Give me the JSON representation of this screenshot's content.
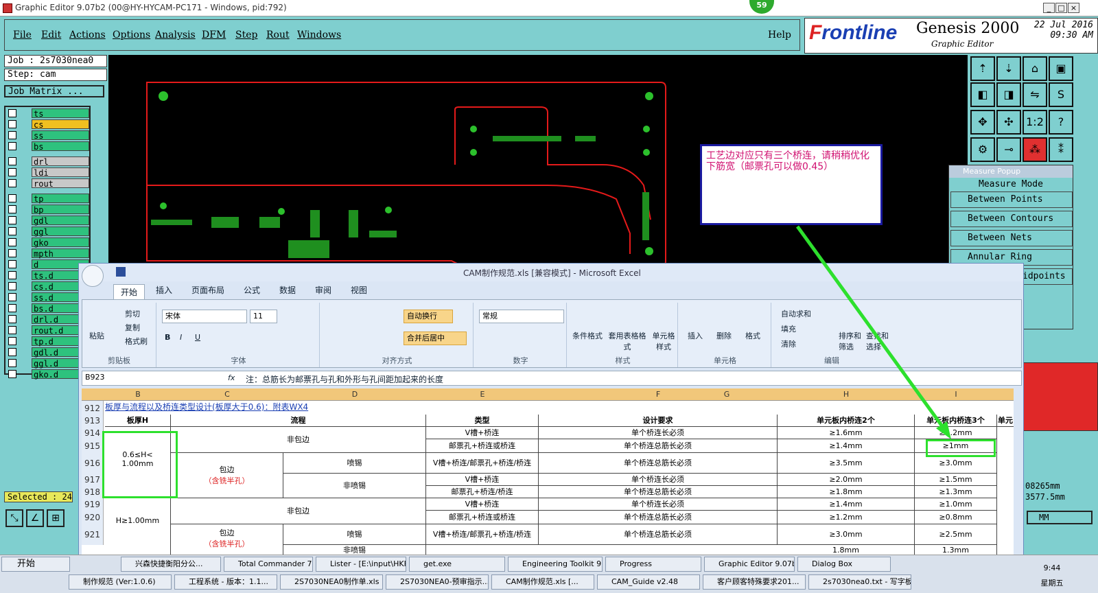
{
  "window": {
    "title": "Graphic Editor 9.07b2 (00@HY-HYCAM-PC171 - Windows, pid:792)",
    "badge": "59"
  },
  "menu": [
    "File",
    "Edit",
    "Actions",
    "Options",
    "Analysis",
    "DFM",
    "Step",
    "Rout",
    "Windows"
  ],
  "help": "Help",
  "brand": {
    "logo_prefix": "F",
    "logo": "rontline",
    "product": "Genesis 2000",
    "subtitle": "Graphic Editor",
    "date": "22 Jul 2016",
    "time": "09:30 AM"
  },
  "job": {
    "job": "Job : 2s7030nea0",
    "step": "Step: cam",
    "matrix": "Job Matrix ..."
  },
  "layers": [
    {
      "name": "ts",
      "color": "#2ec27e"
    },
    {
      "name": "cs",
      "color": "#f0c020"
    },
    {
      "name": "ss",
      "color": "#2ec27e"
    },
    {
      "name": "bs",
      "color": "#2ec27e"
    },
    {
      "name": "drl",
      "color": "#c8c8c8"
    },
    {
      "name": "ldi",
      "color": "#c8c8c8"
    },
    {
      "name": "rout",
      "color": "#c8c8c8"
    },
    {
      "name": "tp",
      "color": "#2ec27e"
    },
    {
      "name": "bp",
      "color": "#2ec27e"
    },
    {
      "name": "gdl",
      "color": "#2ec27e"
    },
    {
      "name": "ggl",
      "color": "#2ec27e"
    },
    {
      "name": "gko",
      "color": "#2ec27e"
    },
    {
      "name": "mpth",
      "color": "#2ec27e"
    },
    {
      "name": "d",
      "color": "#2ec27e"
    },
    {
      "name": "ts.d",
      "color": "#2ec27e"
    },
    {
      "name": "cs.d",
      "color": "#2ec27e"
    },
    {
      "name": "ss.d",
      "color": "#2ec27e"
    },
    {
      "name": "bs.d",
      "color": "#2ec27e"
    },
    {
      "name": "drl.d",
      "color": "#2ec27e"
    },
    {
      "name": "rout.d",
      "color": "#2ec27e"
    },
    {
      "name": "tp.d",
      "color": "#2ec27e"
    },
    {
      "name": "gdl.d",
      "color": "#2ec27e"
    },
    {
      "name": "ggl.d",
      "color": "#2ec27e"
    },
    {
      "name": "gko.d",
      "color": "#2ec27e"
    }
  ],
  "selected": "Selected : 24",
  "measure": {
    "title": "Measure Popup",
    "mode": "Measure Mode",
    "options": [
      "Between Points",
      "Between Contours",
      "Between Nets",
      "Annular Ring",
      "idpoints"
    ]
  },
  "readout": {
    "a": "08265mm",
    "b": "3577.5mm",
    "unit": "MM"
  },
  "callout": "工艺边对应只有三个桥连，请稍稍优化下筋宽（邮票孔可以做0.45）",
  "excel": {
    "title": "CAM制作规范.xls [兼容模式] - Microsoft Excel",
    "tabs": [
      "开始",
      "插入",
      "页面布局",
      "公式",
      "数据",
      "审阅",
      "视图"
    ],
    "clipboard": {
      "paste": "粘贴",
      "cut": "剪切",
      "copy": "复制",
      "format": "格式刷",
      "group": "剪贴板"
    },
    "font": {
      "name": "宋体",
      "size": "11",
      "group": "字体"
    },
    "align": {
      "wrap": "自动换行",
      "merge": "合并后居中",
      "group": "对齐方式"
    },
    "number": {
      "format": "常规",
      "group": "数字"
    },
    "styles": {
      "cond": "条件格式",
      "table": "套用表格格式",
      "cell": "单元格样式",
      "group": "样式"
    },
    "cells": {
      "insert": "插入",
      "delete": "删除",
      "format": "格式",
      "group": "单元格"
    },
    "edit": {
      "sum": "自动求和",
      "fill": "填充",
      "clear": "清除",
      "sort": "排序和筛选",
      "find": "查找和选择",
      "group": "编辑"
    },
    "namebox": "B923",
    "formula": "注：总筋长为邮票孔与孔和外形与孔间距加起来的长度",
    "columns": [
      "B",
      "C",
      "D",
      "E",
      "F",
      "G",
      "H",
      "I"
    ],
    "row912": "板厚与流程以及桥连类型设计(板厚大于0.6)：附表WX4",
    "headers": [
      "板厚H",
      "流程",
      "类型",
      "设计要求",
      "单元板内桥连2个",
      "单元板内桥连3个",
      "单元"
    ],
    "rows": [
      {
        "n": "914",
        "type": "V槽+桥连",
        "req": "单个桥连长必须",
        "h": "≥1.6mm",
        "i": "≥1.2mm"
      },
      {
        "n": "915",
        "type": "邮票孔+桥连或桥连",
        "req": "单个桥连总筋长必须",
        "h": "≥1.4mm",
        "i": "≥1mm"
      },
      {
        "n": "916",
        "type": "V槽+桥连/邮票孔+桥连/桥连",
        "req": "单个桥连总筋长必须",
        "h": "≥3.5mm",
        "i": "≥3.0mm"
      },
      {
        "n": "917",
        "type": "V槽+桥连",
        "req": "单个桥连长必须",
        "h": "≥2.0mm",
        "i": "≥1.5mm"
      },
      {
        "n": "918",
        "type": "邮票孔+桥连/桥连",
        "req": "单个桥连总筋长必须",
        "h": "≥1.8mm",
        "i": "≥1.3mm"
      },
      {
        "n": "919",
        "type": "V槽+桥连",
        "req": "单个桥连长必须",
        "h": "≥1.4mm",
        "i": "≥1.0mm"
      },
      {
        "n": "920",
        "type": "邮票孔+桥连或桥连",
        "req": "单个桥连总筋长必须",
        "h": "≥1.2mm",
        "i": "≥0.8mm"
      },
      {
        "n": "921",
        "type": "V槽+桥连/邮票孔+桥连/桥连",
        "req": "单个桥连总筋长必须",
        "h": "≥3.0mm",
        "i": "≥2.5mm"
      }
    ],
    "labels": {
      "nonwrap": "非包边",
      "wrap": "包边",
      "halfhole": "（含铣半孔）",
      "tin": "喷锡",
      "notin": "非喷锡",
      "h1": "0.6≤H<",
      "h1b": "1.00mm",
      "h2": "H≥1.00mm",
      "cut": "非喷锡",
      "r922": "1.8mm",
      "r922i": "1.3mm"
    }
  },
  "taskbar": {
    "start": "开始",
    "row1": [
      "兴森快捷衡阳分公...",
      "Total Commander 7.0 ...",
      "Lister - [E:\\input\\HKF...",
      "get.exe",
      "Engineering Toolkit 9....",
      "Progress",
      "Graphic Editor 9.07b2 ...",
      "Dialog Box"
    ],
    "row2": [
      "制作规范 (Ver:1.0.6)",
      "工程系统 - 版本：1.1...",
      "2S7030NEA0制作单.xls",
      "2S7030NEA0-预审指示...",
      "CAM制作规范.xls [...",
      "CAM_Guide v2.48",
      "客户顾客特殊要求201...",
      "2s7030nea0.txt - 写字板"
    ],
    "clock": "9:44",
    "weekday": "星期五"
  }
}
